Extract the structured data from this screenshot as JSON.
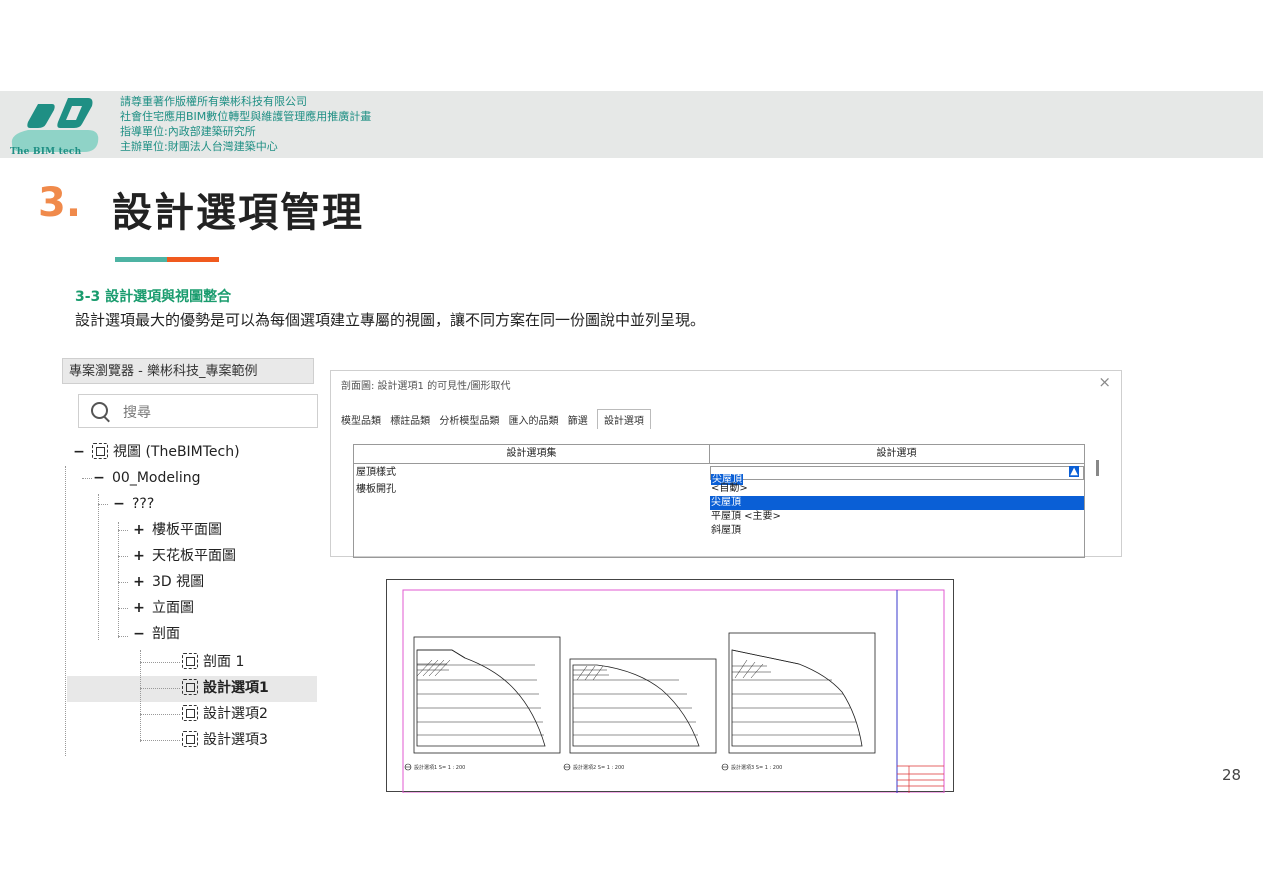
{
  "header": {
    "logo_text": "The BIM tech",
    "credits": [
      "請尊重著作版權所有樂彬科技有限公司",
      "社會住宅應用BIM數位轉型與維護管理應用推廣計畫",
      "指導單位:內政部建築研究所",
      "主辦單位:財團法人台灣建築中心"
    ]
  },
  "title": {
    "number": "3.",
    "text": "設計選項管理"
  },
  "section": {
    "subhead": "3-3 設計選項與視圖整合",
    "body": "設計選項最大的優勢是可以為每個選項建立專屬的視圖，讓不同方案在同一份圖說中並列呈現。"
  },
  "browser": {
    "title": "專案瀏覽器 - 樂彬科技_專案範例",
    "search_placeholder": "搜尋",
    "items": [
      {
        "expander": "−",
        "label": "視圖 (TheBIMTech)"
      },
      {
        "expander": "−",
        "label": "00_Modeling"
      },
      {
        "expander": "−",
        "label": "???"
      },
      {
        "expander": "+",
        "label": "樓板平面圖"
      },
      {
        "expander": "+",
        "label": "天花板平面圖"
      },
      {
        "expander": "+",
        "label": "3D 視圖"
      },
      {
        "expander": "+",
        "label": "立面圖"
      },
      {
        "expander": "−",
        "label": "剖面"
      },
      {
        "label": "剖面 1"
      },
      {
        "label": "設計選項1"
      },
      {
        "label": "設計選項2"
      },
      {
        "label": "設計選項3"
      }
    ]
  },
  "dialog": {
    "title": "剖面圖: 設計選項1 的可見性/圖形取代",
    "close": "×",
    "tabs": [
      "模型品類",
      "標註品類",
      "分析模型品類",
      "匯入的品類",
      "篩選",
      "設計選項"
    ],
    "columns": [
      "設計選項集",
      "設計選項"
    ],
    "rows": [
      "屋頂樣式",
      "樓板開孔"
    ],
    "selected_value": "尖屋頂",
    "options": [
      "<自動>",
      "尖屋頂",
      "平屋頂 <主要>",
      "斜屋頂"
    ]
  },
  "sheet": {
    "view_labels": [
      "設計選項1  S= 1 : 200",
      "設計選項2  S= 1 : 200",
      "設計選項3  S= 1 : 200"
    ]
  },
  "page_number": "28",
  "colors": {
    "accent_teal": "#1f8f84",
    "accent_orange": "#f08a4b",
    "highlight_blue": "#0a5fd6"
  }
}
